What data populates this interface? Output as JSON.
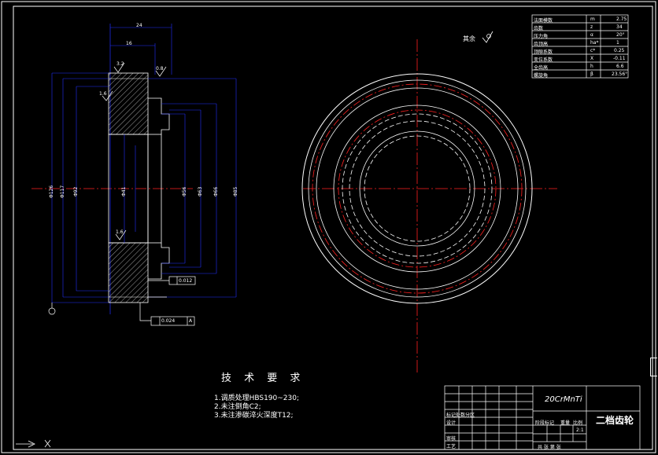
{
  "drawing": {
    "part_name": "二档齿轮",
    "material": "20CrMnTi",
    "surface_note": "其余",
    "tech_requirements": {
      "title": "技 术 要 求",
      "items": [
        "1.调质处理HBS190~230;",
        "2.未注倒角C2;",
        "3.未注渗碳淬火深度T12;"
      ]
    }
  },
  "param_table": [
    {
      "name": "法面模数",
      "sym": "m",
      "val": "2.75"
    },
    {
      "name": "齿数",
      "sym": "z",
      "val": "34"
    },
    {
      "name": "压力角",
      "sym": "α",
      "val": "20°"
    },
    {
      "name": "齿顶高",
      "sym": "ha*",
      "val": "1"
    },
    {
      "name": "顶隙系数",
      "sym": "c*",
      "val": "0.25"
    },
    {
      "name": "变位系数",
      "sym": "X",
      "val": "-0.11"
    },
    {
      "name": "全齿高",
      "sym": "h",
      "val": "6.6"
    },
    {
      "name": "螺旋角",
      "sym": "β",
      "val": "23.56°"
    }
  ],
  "title_block": {
    "row_labels": [
      "标记处数分区",
      "设计",
      "审核",
      "工艺"
    ],
    "stage_label": "阶段标记",
    "weight_label": "重量",
    "scale_label": "比例",
    "scale_value": "2:1",
    "sheets_label": "共 张 第 张"
  },
  "annotations": {
    "roughness": [
      "3.2",
      "0.8",
      "1.6",
      "1.6"
    ],
    "tolerance_a": "0.012",
    "tolerance_b": "0.024",
    "datum": "A",
    "top_dim": "24",
    "sub_dim": "16",
    "v_dims": [
      "Φ126",
      "Φ117",
      "Φ92",
      "Φ41",
      "Φ56",
      "Φ63",
      "Φ66",
      "Φ85"
    ]
  },
  "colors": {
    "frame": "#ffffff",
    "center": "#ff2020",
    "dim": "#2030ff",
    "section": "#c8c8c8",
    "text": "#ffffff"
  }
}
